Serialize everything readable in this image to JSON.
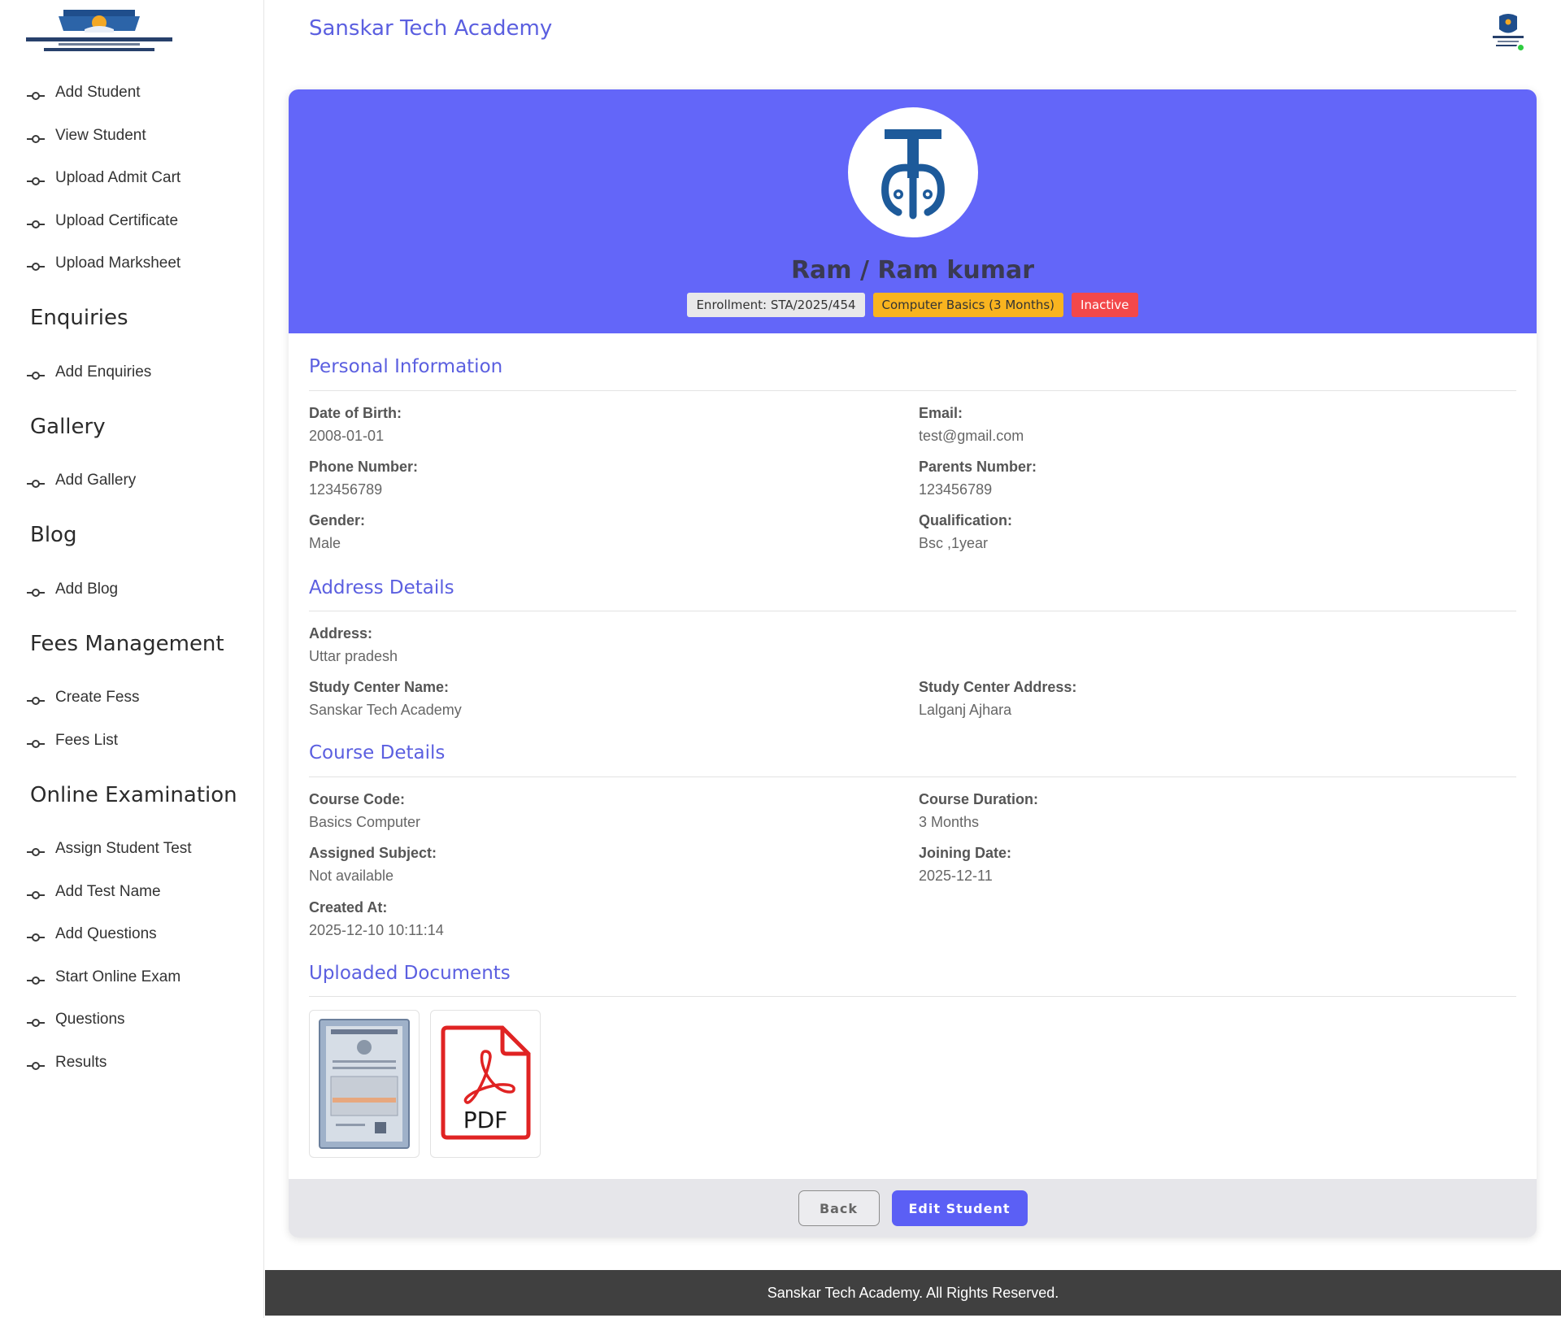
{
  "header": {
    "title": "Sanskar Tech Academy"
  },
  "sidebar": {
    "items": [
      {
        "type": "link",
        "label": "Add Student"
      },
      {
        "type": "link",
        "label": "View Student"
      },
      {
        "type": "link",
        "label": "Upload Admit Cart"
      },
      {
        "type": "link",
        "label": "Upload Certificate"
      },
      {
        "type": "link",
        "label": "Upload Marksheet"
      },
      {
        "type": "heading",
        "label": "Enquiries"
      },
      {
        "type": "link",
        "label": "Add Enquiries"
      },
      {
        "type": "heading",
        "label": "Gallery"
      },
      {
        "type": "link",
        "label": "Add Gallery"
      },
      {
        "type": "heading",
        "label": "Blog"
      },
      {
        "type": "link",
        "label": "Add Blog"
      },
      {
        "type": "heading",
        "label": "Fees Management"
      },
      {
        "type": "link",
        "label": "Create Fess"
      },
      {
        "type": "link",
        "label": "Fees List"
      },
      {
        "type": "heading",
        "label": "Online Examination"
      },
      {
        "type": "link",
        "label": "Assign Student Test"
      },
      {
        "type": "link",
        "label": "Add Test Name"
      },
      {
        "type": "link",
        "label": "Add Questions"
      },
      {
        "type": "link",
        "label": "Start Online Exam"
      },
      {
        "type": "link",
        "label": "Questions"
      },
      {
        "type": "link",
        "label": "Results"
      }
    ]
  },
  "student": {
    "name": "Ram / Ram kumar",
    "enrollment": "Enrollment: STA/2025/454",
    "course_badge": "Computer Basics (3 Months)",
    "status": "Inactive"
  },
  "sections": {
    "personal": "Personal Information",
    "address": "Address Details",
    "course": "Course Details",
    "documents": "Uploaded Documents"
  },
  "personal": {
    "dob": {
      "label": "Date of Birth:",
      "value": "2008-01-01"
    },
    "email": {
      "label": "Email:",
      "value": "test@gmail.com"
    },
    "phone": {
      "label": "Phone Number:",
      "value": "123456789"
    },
    "parents": {
      "label": "Parents Number:",
      "value": "123456789"
    },
    "gender": {
      "label": "Gender:",
      "value": "Male"
    },
    "qualification": {
      "label": "Qualification:",
      "value": "Bsc ,1year"
    }
  },
  "address": {
    "address": {
      "label": "Address:",
      "value": "Uttar pradesh"
    },
    "center_name": {
      "label": "Study Center Name:",
      "value": "Sanskar Tech Academy"
    },
    "center_address": {
      "label": "Study Center Address:",
      "value": "Lalganj Ajhara"
    }
  },
  "course": {
    "code": {
      "label": "Course Code:",
      "value": "Basics Computer"
    },
    "duration": {
      "label": "Course Duration:",
      "value": "3 Months"
    },
    "subject": {
      "label": "Assigned Subject:",
      "value": "Not available"
    },
    "joining": {
      "label": "Joining Date:",
      "value": "2025-12-11"
    },
    "created": {
      "label": "Created At:",
      "value": "2025-12-10 10:11:14"
    }
  },
  "documents": {
    "pdf_label": "PDF"
  },
  "buttons": {
    "back": "Back",
    "edit": "Edit Student"
  },
  "footer": {
    "text": "Sanskar Tech Academy. All Rights Reserved."
  },
  "colors": {
    "accent": "#6366f9",
    "banner": "#6366f9",
    "badge_course": "#f9b41f",
    "badge_inactive": "#f3484a",
    "online": "#2ecc40"
  }
}
